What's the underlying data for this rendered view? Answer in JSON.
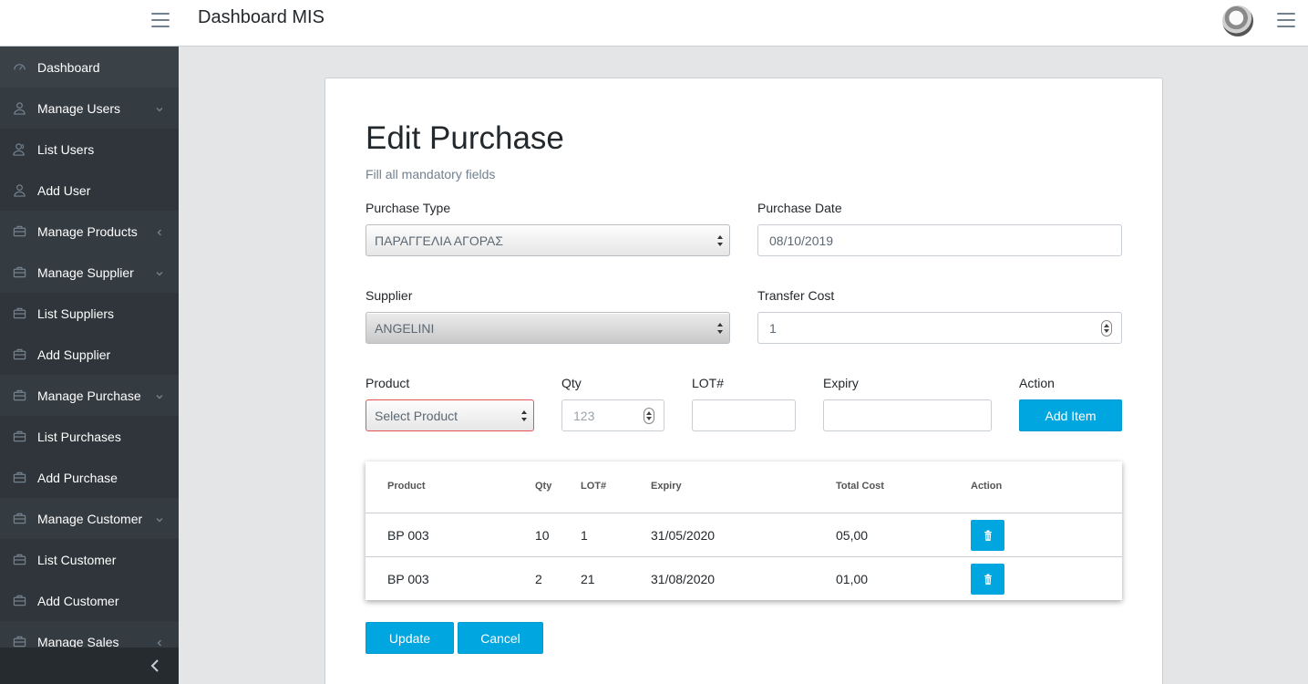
{
  "header": {
    "brand": "Dashboard MIS"
  },
  "sidebar": {
    "items": [
      {
        "label": "Dashboard",
        "icon": "speedometer-icon"
      },
      {
        "label": "Manage Users",
        "icon": "user-icon"
      },
      {
        "label": "List Users",
        "icon": "users-icon"
      },
      {
        "label": "Add User",
        "icon": "user-icon"
      },
      {
        "label": "Manage Products",
        "icon": "briefcase-icon"
      },
      {
        "label": "Manage Supplier",
        "icon": "briefcase-icon"
      },
      {
        "label": "List Suppliers",
        "icon": "briefcase-icon"
      },
      {
        "label": "Add Supplier",
        "icon": "briefcase-icon"
      },
      {
        "label": "Manage Purchase",
        "icon": "briefcase-icon"
      },
      {
        "label": "List Purchases",
        "icon": "briefcase-icon"
      },
      {
        "label": "Add Purchase",
        "icon": "briefcase-icon"
      },
      {
        "label": "Manage Customer",
        "icon": "briefcase-icon"
      },
      {
        "label": "List Customer",
        "icon": "briefcase-icon"
      },
      {
        "label": "Add Customer",
        "icon": "briefcase-icon"
      },
      {
        "label": "Manage Sales",
        "icon": "briefcase-icon"
      }
    ]
  },
  "form": {
    "title": "Edit Purchase",
    "subtitle": "Fill all mandatory fields",
    "purchase_type_label": "Purchase Type",
    "purchase_type_value": "ΠΑΡΑΓΓΕΛΙΑ ΑΓΟΡΑΣ",
    "purchase_date_label": "Purchase Date",
    "purchase_date_value": "08/10/2019",
    "supplier_label": "Supplier",
    "supplier_value": "ANGELINI",
    "transfer_cost_label": "Transfer Cost",
    "transfer_cost_value": "1",
    "product_label": "Product",
    "product_value": "Select Product",
    "qty_label": "Qty",
    "qty_placeholder": "123",
    "lot_label": "LOT#",
    "expiry_label": "Expiry",
    "action_label": "Action",
    "add_item": "Add Item",
    "update": "Update",
    "cancel": "Cancel"
  },
  "table": {
    "headers": [
      "Product",
      "Qty",
      "LOT#",
      "Expiry",
      "Total Cost",
      "Action"
    ],
    "rows": [
      {
        "product": "BP 003",
        "qty": "10",
        "lot": "1",
        "expiry": "31/05/2020",
        "total_cost": "05,00"
      },
      {
        "product": "BP 003",
        "qty": "2",
        "lot": "21",
        "expiry": "31/08/2020",
        "total_cost": "01,00"
      }
    ]
  },
  "colors": {
    "accent": "#00a6e0",
    "sidebar": "#2f353a"
  }
}
